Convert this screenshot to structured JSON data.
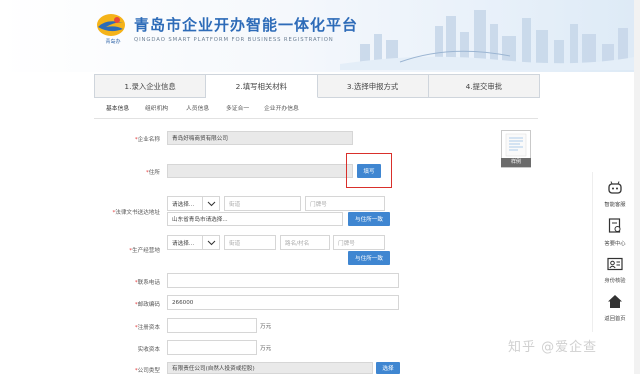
{
  "header": {
    "title": "青岛市企业开办智能一体化平台",
    "subtitle": "QINGDAO SMART PLATFORM FOR BUSINESS REGISTRATION",
    "logo_text": "青岛办",
    "brand_color": "#2d6bb8"
  },
  "steps": [
    {
      "label": "1.录入企业信息"
    },
    {
      "label": "2.填写相关材料",
      "active": true
    },
    {
      "label": "3.选择申报方式"
    },
    {
      "label": "4.提交审批"
    }
  ],
  "subtabs": [
    {
      "label": "基本信息",
      "active": true
    },
    {
      "label": "组织机构"
    },
    {
      "label": "人员信息"
    },
    {
      "label": "多证合一"
    },
    {
      "label": "企业开办信息"
    }
  ],
  "form": {
    "company_name": {
      "label": "企业名称",
      "value": "青岛好嗨商贸有限公司"
    },
    "address": {
      "label": "住所",
      "value": "",
      "fill_button": "填写"
    },
    "legal_address": {
      "label": "法律文书送达地址",
      "select_placeholder": "请选择...",
      "street_placeholder": "街道",
      "door_placeholder": "门牌号",
      "detail_value": "山东省青岛市请选择...",
      "same_button": "与住所一致"
    },
    "business_place": {
      "label": "生产经营地",
      "select_placeholder": "请选择...",
      "street_placeholder": "街道",
      "road_placeholder": "路名/村名",
      "door_placeholder": "门牌号",
      "same_button": "与住所一致"
    },
    "phone": {
      "label": "联系电话",
      "value": ""
    },
    "postcode": {
      "label": "邮政编码",
      "value": "266000"
    },
    "registered_capital": {
      "label": "注册资本",
      "value": "",
      "unit": "万元"
    },
    "paid_capital": {
      "label": "实收资本",
      "value": "",
      "unit": "万元"
    },
    "company_type": {
      "label": "公司类型",
      "value": "有限责任公司(自然人投资或控股)",
      "select_button": "选择"
    }
  },
  "sample": {
    "label": "样例"
  },
  "sidebar": [
    {
      "label": "智能客服",
      "icon": "robot-icon"
    },
    {
      "label": "答要中心",
      "icon": "document-icon"
    },
    {
      "label": "身份核验",
      "icon": "id-card-icon"
    },
    {
      "label": "返回首页",
      "icon": "home-icon"
    }
  ],
  "watermark": "知乎 @爱企查",
  "colors": {
    "accent": "#3f86d1",
    "highlight": "#d9302b",
    "required": "#e23b3b"
  }
}
